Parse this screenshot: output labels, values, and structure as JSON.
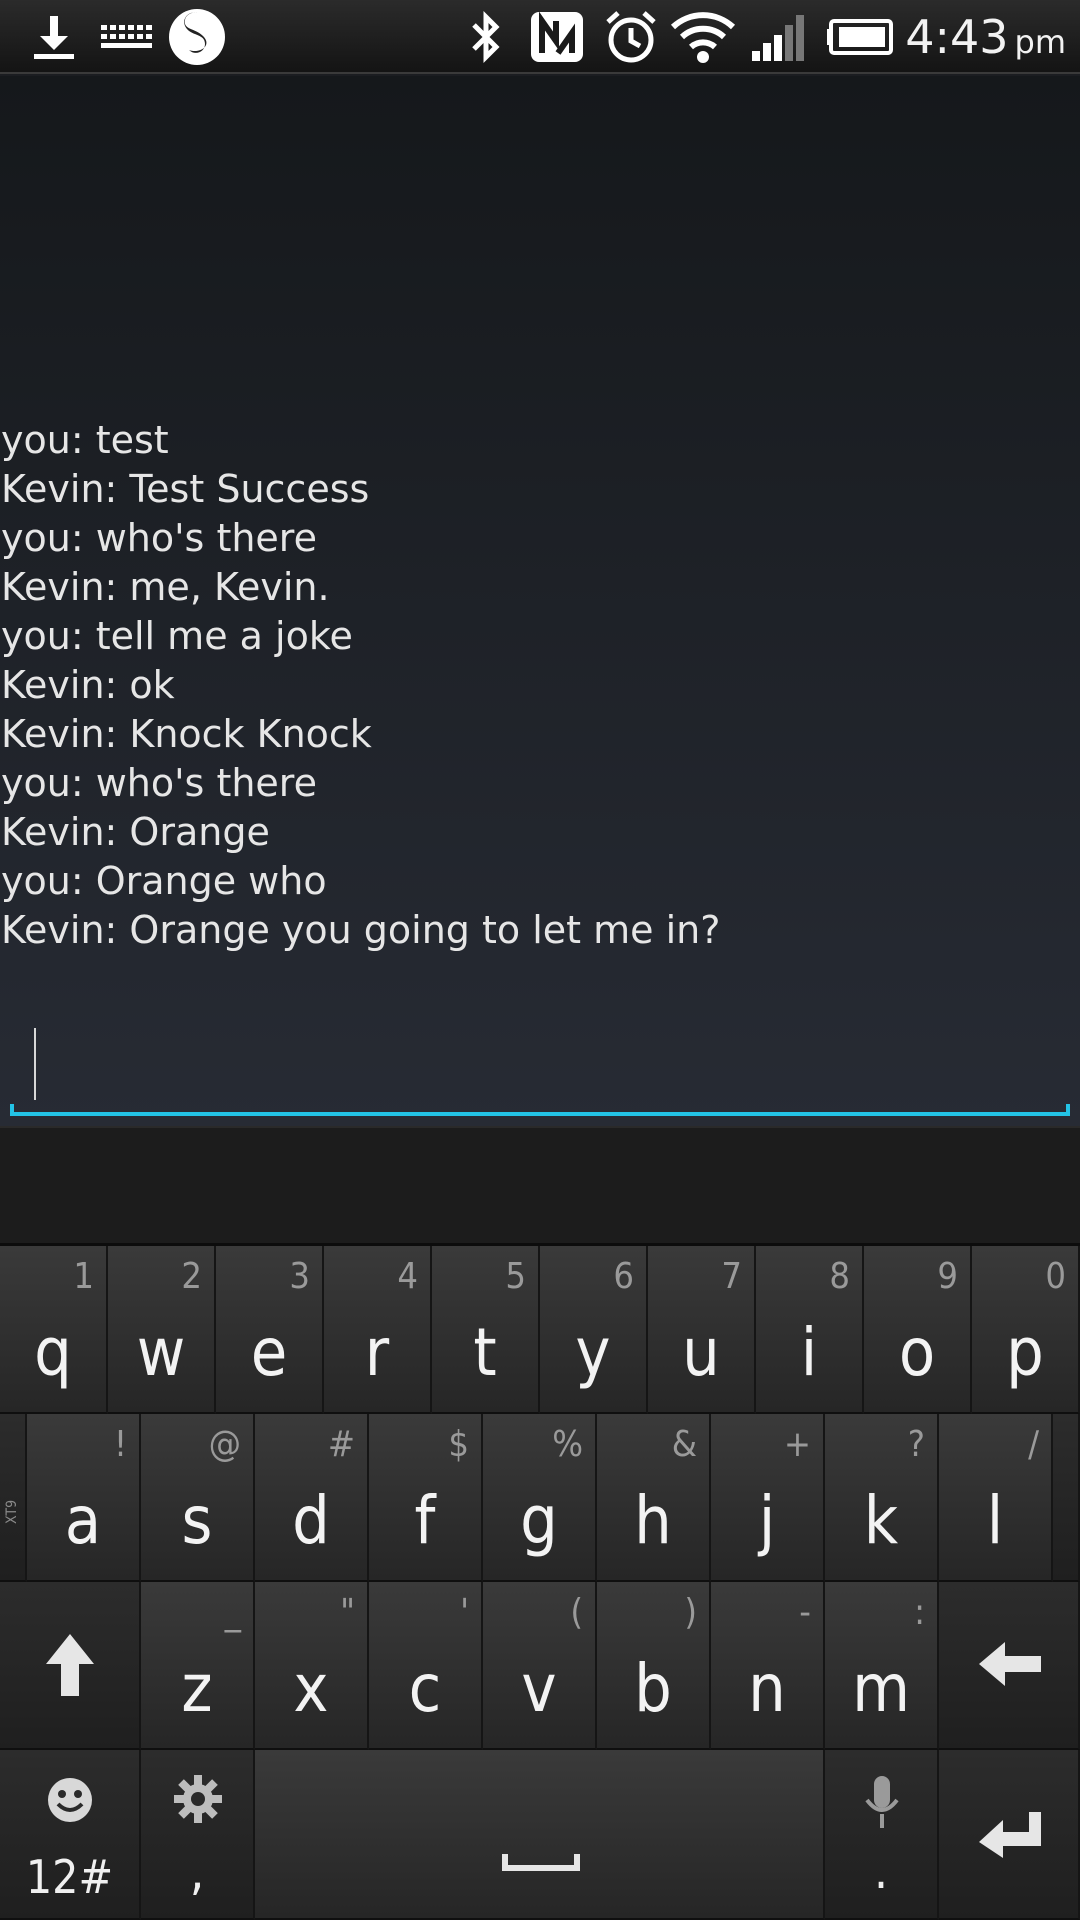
{
  "status_bar": {
    "icons": [
      "download-icon",
      "keyboard-icon",
      "app-s-icon",
      "bluetooth-icon",
      "nfc-icon",
      "alarm-icon",
      "wifi-icon",
      "signal-icon",
      "battery-icon"
    ],
    "time": "4:43",
    "ampm": "pm"
  },
  "chat": {
    "messages": [
      "you: test",
      "Kevin: Test Success",
      "you: who's there",
      "Kevin: me, Kevin.",
      "you: tell me a joke",
      "Kevin: ok",
      "Kevin: Knock Knock",
      "you: who's there",
      "Kevin: Orange",
      "you: Orange who",
      "Kevin: Orange you going to let me in?"
    ],
    "input_value": "",
    "accent_color": "#23c3e6"
  },
  "keyboard": {
    "row1": [
      {
        "key": "q",
        "hint": "1"
      },
      {
        "key": "w",
        "hint": "2"
      },
      {
        "key": "e",
        "hint": "3"
      },
      {
        "key": "r",
        "hint": "4"
      },
      {
        "key": "t",
        "hint": "5"
      },
      {
        "key": "y",
        "hint": "6"
      },
      {
        "key": "u",
        "hint": "7"
      },
      {
        "key": "i",
        "hint": "8"
      },
      {
        "key": "o",
        "hint": "9"
      },
      {
        "key": "p",
        "hint": "0"
      }
    ],
    "row2": [
      {
        "key": "a",
        "hint": "!"
      },
      {
        "key": "s",
        "hint": "@"
      },
      {
        "key": "d",
        "hint": "#"
      },
      {
        "key": "f",
        "hint": "$"
      },
      {
        "key": "g",
        "hint": "%"
      },
      {
        "key": "h",
        "hint": "&"
      },
      {
        "key": "j",
        "hint": "+"
      },
      {
        "key": "k",
        "hint": "?"
      },
      {
        "key": "l",
        "hint": "/"
      }
    ],
    "row3": [
      {
        "key": "z",
        "hint": "_"
      },
      {
        "key": "x",
        "hint": "\""
      },
      {
        "key": "c",
        "hint": "'"
      },
      {
        "key": "v",
        "hint": "("
      },
      {
        "key": "b",
        "hint": ")"
      },
      {
        "key": "n",
        "hint": "-"
      },
      {
        "key": "m",
        "hint": ":"
      }
    ],
    "xt9_label": "XT9",
    "numbers_label": "12#",
    "comma_label": ",",
    "period_label": "."
  }
}
